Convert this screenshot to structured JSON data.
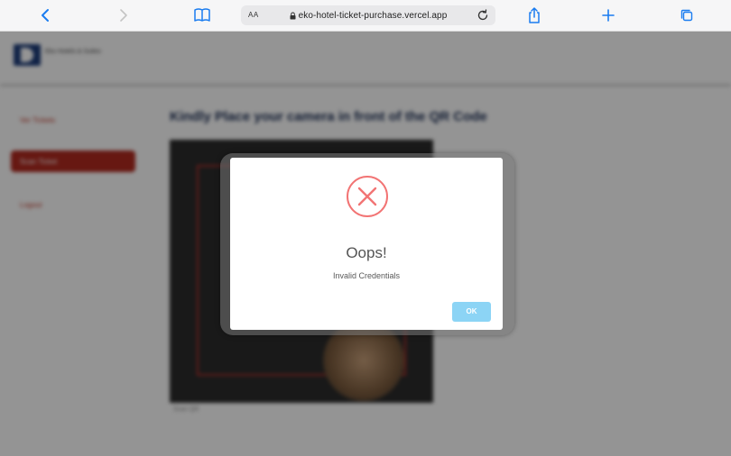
{
  "browser": {
    "url": "eko-hotel-ticket-purchase.vercel.app",
    "text_size_label": "AA"
  },
  "page": {
    "heading": "Kindly Place your camera in front of the QR Code",
    "logo_text": "Eko Hotels & Suites",
    "sidebar": {
      "items": [
        {
          "label": "Ver Tickets"
        },
        {
          "label": "Scan Ticket"
        },
        {
          "label": "Logout"
        }
      ]
    },
    "camera_caption": "Scan QR"
  },
  "modal": {
    "icon": "error-x-icon",
    "title": "Oops!",
    "message": "Invalid Credentials",
    "ok_label": "OK",
    "colors": {
      "error": "#f27474",
      "ok_button": "#8cd4f5"
    }
  }
}
